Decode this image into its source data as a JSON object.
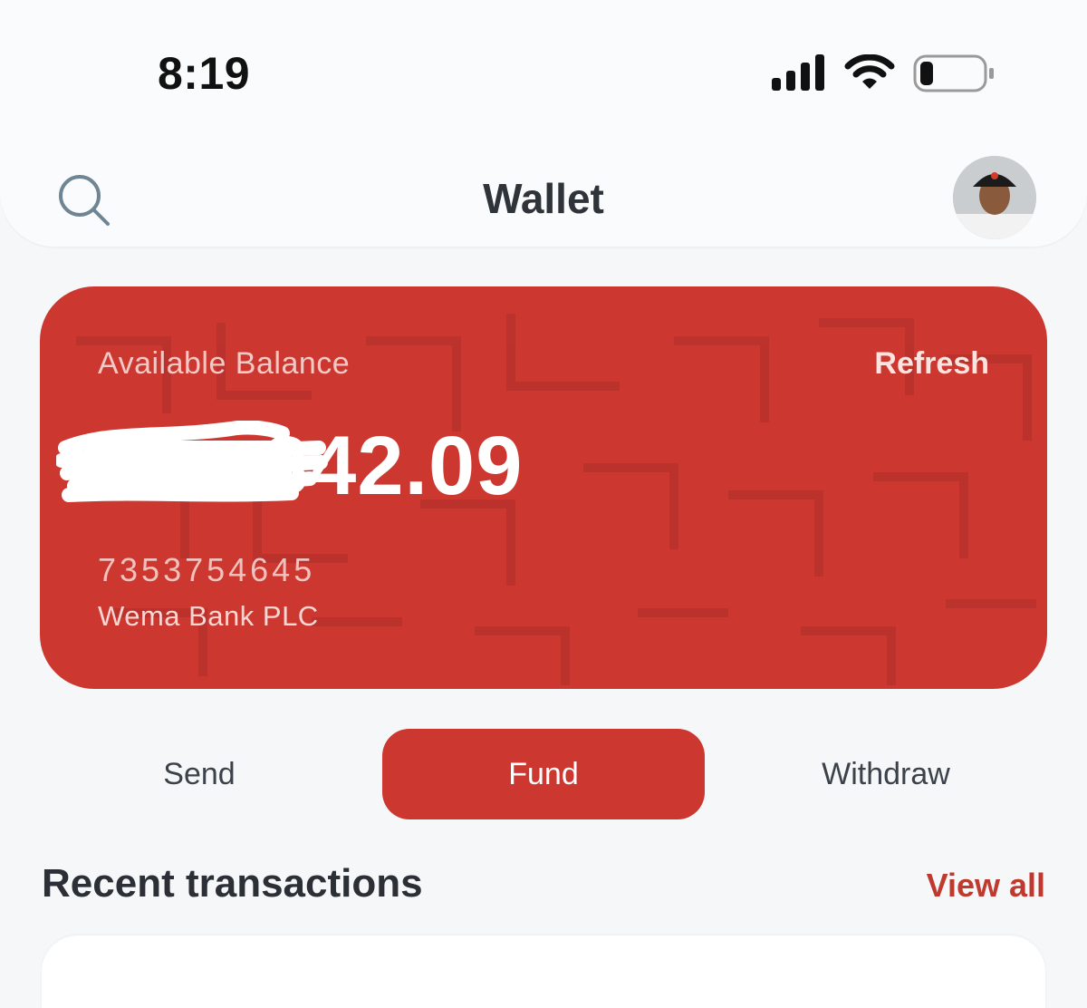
{
  "status_bar": {
    "time": "8:19"
  },
  "header": {
    "title": "Wallet"
  },
  "balance_card": {
    "label": "Available Balance",
    "refresh_label": "Refresh",
    "amount_visible": "342.09",
    "account_number": "7353754645",
    "bank_name": "Wema Bank PLC",
    "color": "#cc3730"
  },
  "actions": {
    "send_label": "Send",
    "fund_label": "Fund",
    "withdraw_label": "Withdraw"
  },
  "recent": {
    "title": "Recent transactions",
    "view_all_label": "View all"
  },
  "colors": {
    "accent": "#cc3730",
    "link": "#c0392f",
    "background": "#f5f7f8"
  },
  "icons": [
    "signal-icon",
    "wifi-icon",
    "battery-icon",
    "search-icon"
  ]
}
